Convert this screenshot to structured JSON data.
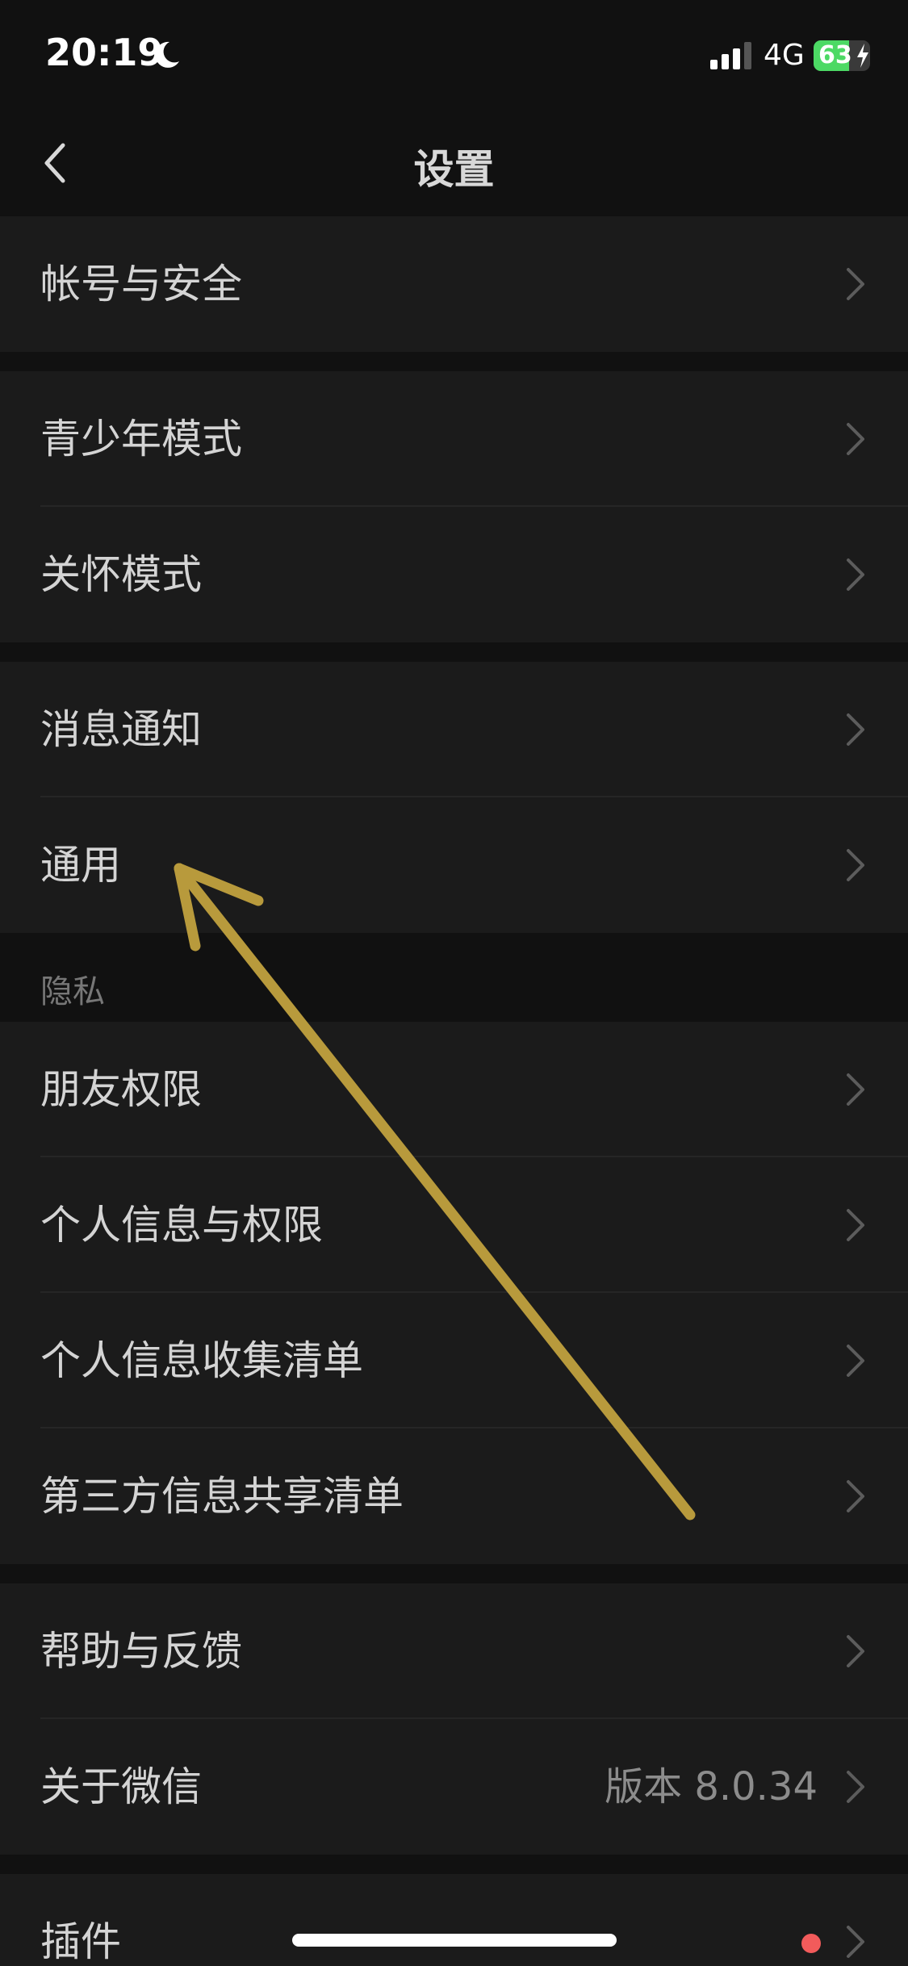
{
  "status_bar": {
    "time": "20:19",
    "network": "4G",
    "battery": "63",
    "battery_level": 0.63
  },
  "nav": {
    "title": "设置"
  },
  "groups": [
    {
      "items": [
        {
          "label": "帐号与安全"
        }
      ]
    },
    {
      "items": [
        {
          "label": "青少年模式"
        },
        {
          "label": "关怀模式"
        }
      ]
    },
    {
      "items": [
        {
          "label": "消息通知"
        },
        {
          "label": "通用"
        }
      ]
    },
    {
      "section_label": "隐私",
      "items": [
        {
          "label": "朋友权限"
        },
        {
          "label": "个人信息与权限"
        },
        {
          "label": "个人信息收集清单"
        },
        {
          "label": "第三方信息共享清单"
        }
      ]
    },
    {
      "items": [
        {
          "label": "帮助与反馈"
        },
        {
          "label": "关于微信",
          "value": "版本 8.0.34"
        }
      ]
    },
    {
      "items": [
        {
          "label": "插件",
          "badge": "red-dot"
        }
      ]
    }
  ],
  "colors": {
    "background": "#111111",
    "cell": "#1b1b1b",
    "annotation_arrow": "#b89a3c",
    "badge": "#f25b5b"
  }
}
